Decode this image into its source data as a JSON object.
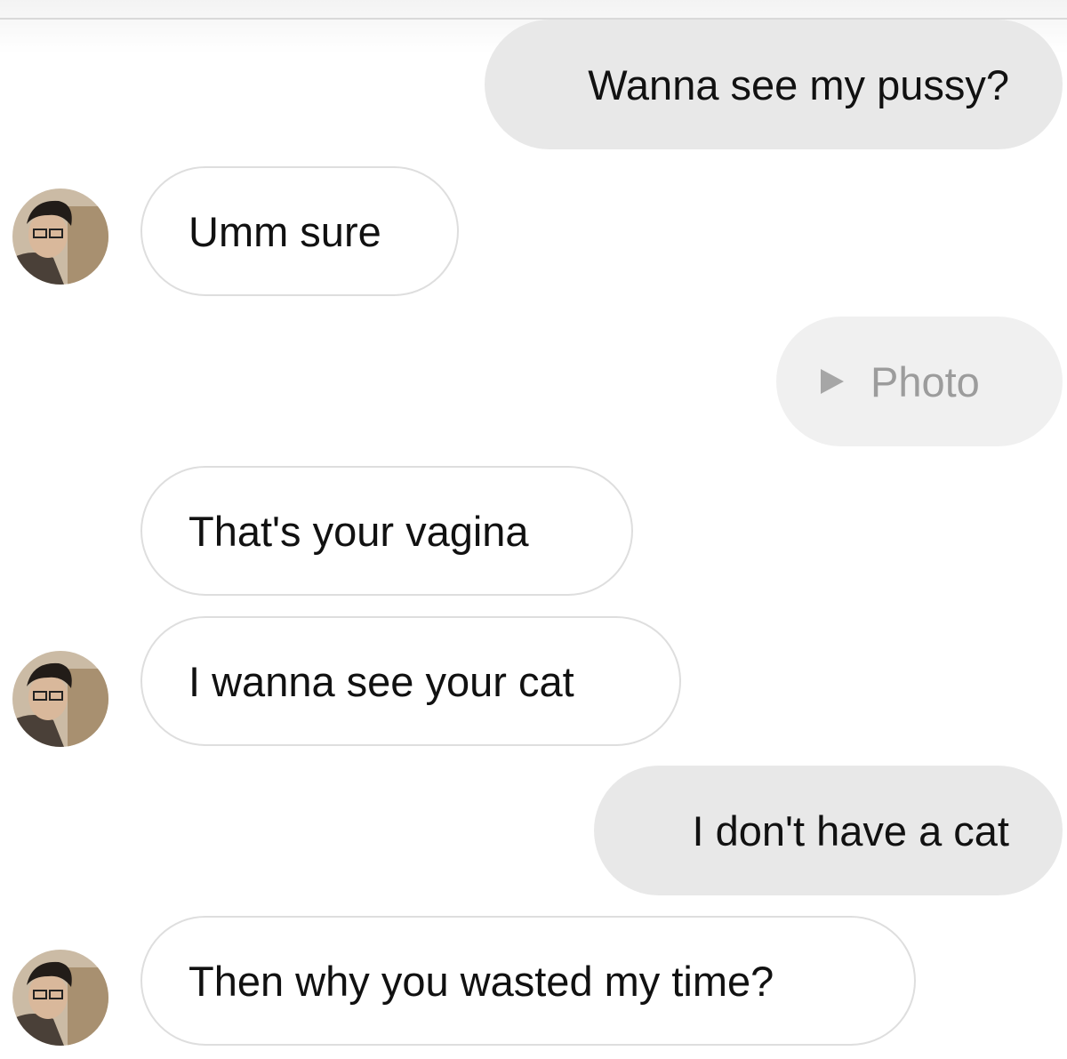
{
  "messages": [
    {
      "type": "sent",
      "text": "Wanna see my pussy?"
    },
    {
      "type": "received",
      "text": "Umm sure"
    },
    {
      "type": "sent-photo",
      "text": "Photo",
      "icon": "play-icon"
    },
    {
      "type": "received",
      "text": "That's your vagina"
    },
    {
      "type": "received",
      "text": "I wanna see your cat"
    },
    {
      "type": "sent",
      "text": "I don't have a cat"
    },
    {
      "type": "received",
      "text": "Then why you wasted my time?"
    }
  ],
  "colors": {
    "sent_bubble": "#e8e8e8",
    "received_bubble": "#ffffff",
    "received_border": "#dedede",
    "photo_text": "#9c9c9c"
  }
}
